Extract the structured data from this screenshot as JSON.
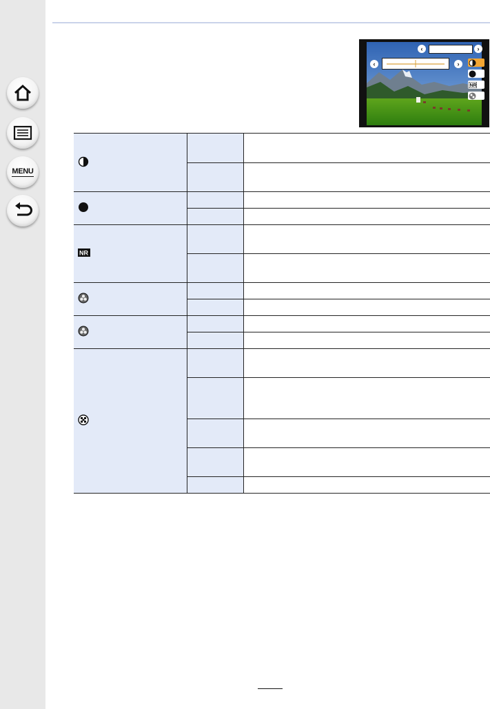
{
  "nav": {
    "home": {
      "icon": "home-icon"
    },
    "contents": {
      "icon": "list-icon"
    },
    "menu": {
      "label": "MENU",
      "icon": "menu-icon"
    },
    "back": {
      "icon": "back-arrow-icon"
    }
  },
  "screenshot": {
    "selected_icon": "contrast-icon",
    "icons": [
      "contrast-icon",
      "saturation-icon",
      "noise-reduction-icon",
      "filter-effect-icon"
    ]
  },
  "table": {
    "rows": [
      {
        "item_icon": "contrast-icon",
        "options": [
          "",
          ""
        ]
      },
      {
        "item_icon": "saturation-icon",
        "options": [
          "",
          ""
        ]
      },
      {
        "item_icon": "noise-reduction-icon",
        "options": [
          "",
          ""
        ]
      },
      {
        "item_icon": "color-tone-icon",
        "options": [
          "",
          ""
        ]
      },
      {
        "item_icon": "color-tone-icon",
        "options": [
          "",
          ""
        ]
      },
      {
        "item_icon": "filter-effect-icon",
        "options": [
          "",
          "",
          "",
          "",
          ""
        ]
      }
    ]
  },
  "colors": {
    "rule": "#c9d3ea",
    "table_header_bg": "#e3eaf8",
    "selected_icon_bg": "#f3a633",
    "rail_bg": "#e8e8e8"
  }
}
